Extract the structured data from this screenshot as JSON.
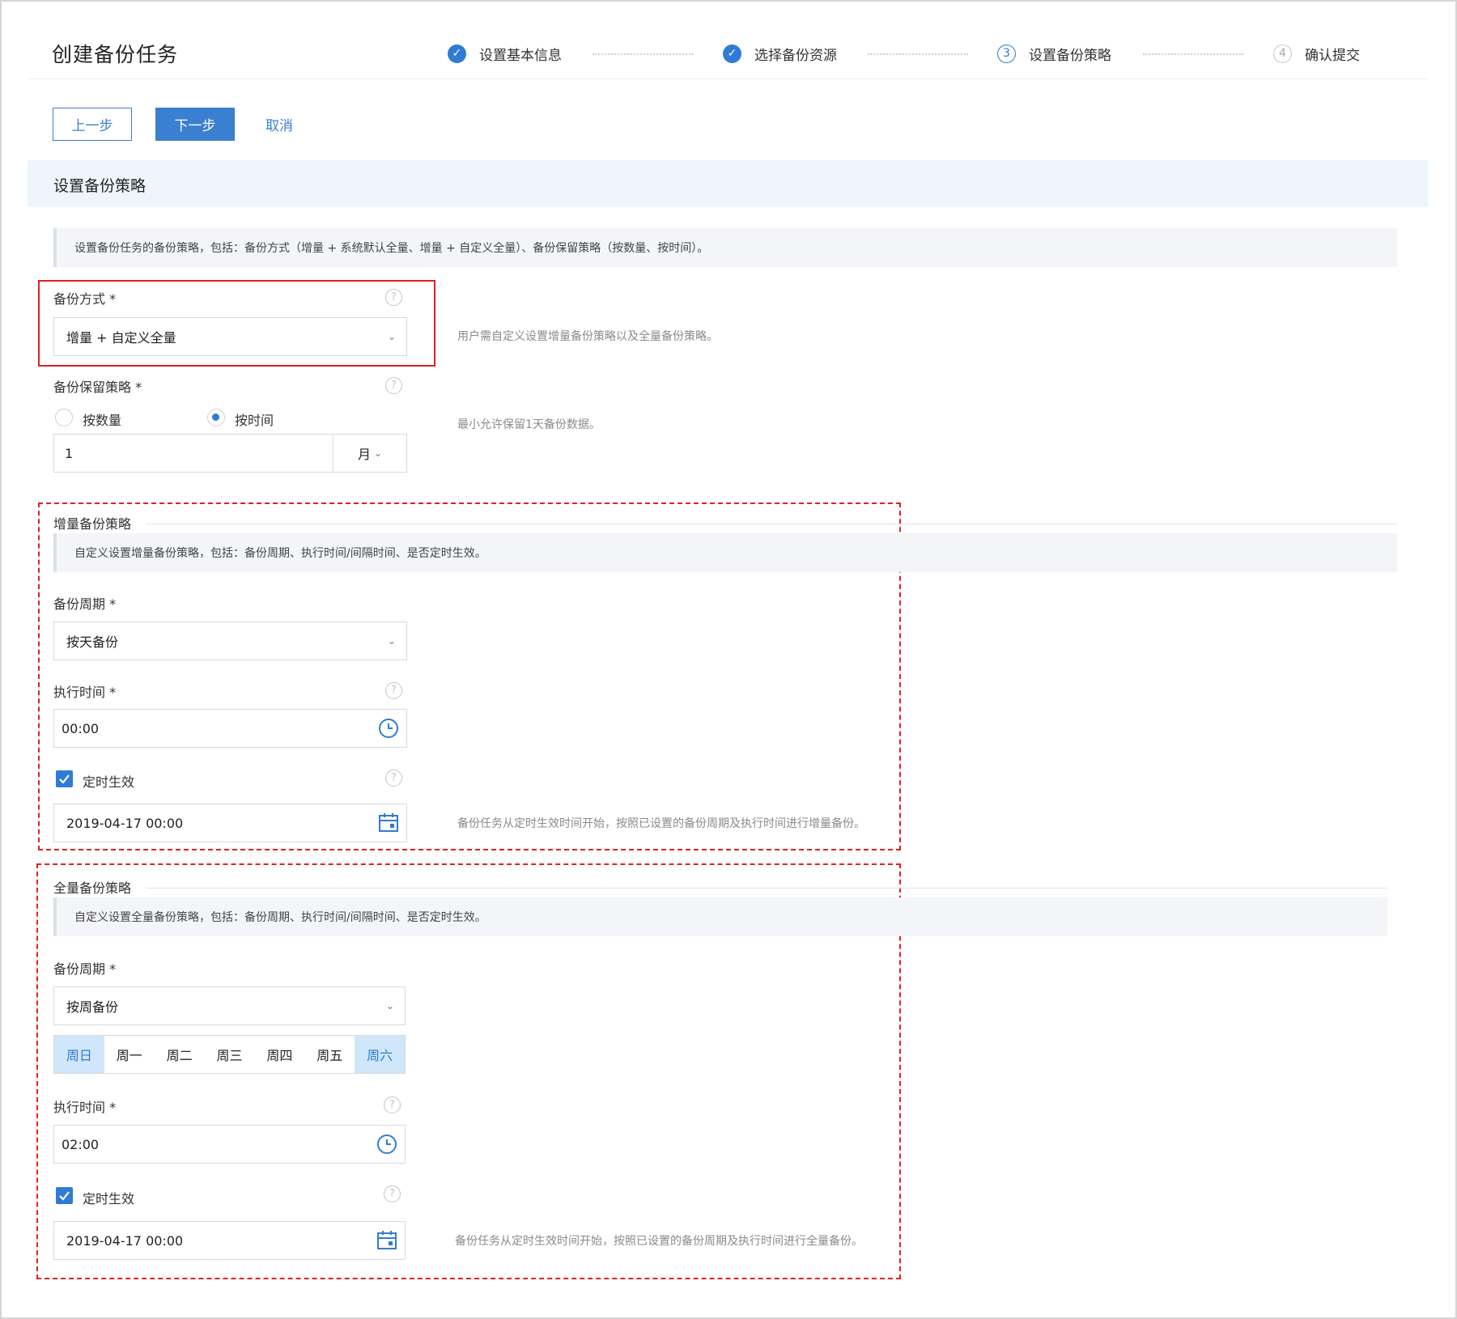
{
  "header": {
    "title": "创建备份任务",
    "steps": [
      {
        "label": "设置基本信息",
        "mark": "✓",
        "state": "done"
      },
      {
        "label": "选择备份资源",
        "mark": "✓",
        "state": "done"
      },
      {
        "label": "设置备份策略",
        "mark": "3",
        "state": "active"
      },
      {
        "label": "确认提交",
        "mark": "4",
        "state": "todo"
      }
    ]
  },
  "toolbar": {
    "prev_label": "上一步",
    "next_label": "下一步",
    "cancel_label": "取消"
  },
  "section": {
    "title": "设置备份策略",
    "notice": "设置备份任务的备份策略，包括：备份方式（增量 + 系统默认全量、增量 + 自定义全量）、备份保留策略（按数量、按时间）。"
  },
  "backup_mode": {
    "label": "备份方式 *",
    "value": "增量 + 自定义全量",
    "hint": "用户需自定义设置增量备份策略以及全量备份策略。"
  },
  "retention": {
    "label": "备份保留策略 *",
    "option_count": "按数量",
    "option_time": "按时间",
    "selected": "按时间",
    "value": "1",
    "unit": "月",
    "hint": "最小允许保留1天备份数据。"
  },
  "incremental": {
    "title": "增量备份策略",
    "notice": "自定义设置增量备份策略，包括：备份周期、执行时间/间隔时间、是否定时生效。",
    "cycle_label": "备份周期 *",
    "cycle_value": "按天备份",
    "time_label": "执行时间 *",
    "time_value": "00:00",
    "timed_label": "定时生效",
    "timed_checked": true,
    "datetime_value": "2019-04-17 00:00",
    "hint": "备份任务从定时生效时间开始，按照已设置的备份周期及执行时间进行增量备份。"
  },
  "full": {
    "title": "全量备份策略",
    "notice": "自定义设置全量备份策略，包括：备份周期、执行时间/间隔时间、是否定时生效。",
    "cycle_label": "备份周期 *",
    "cycle_value": "按周备份",
    "weekdays": [
      "周日",
      "周一",
      "周二",
      "周三",
      "周四",
      "周五",
      "周六"
    ],
    "selected_weekdays": [
      "周日",
      "周六"
    ],
    "time_label": "执行时间 *",
    "time_value": "02:00",
    "timed_label": "定时生效",
    "timed_checked": true,
    "datetime_value": "2019-04-17 00:00",
    "hint": "备份任务从定时生效时间开始，按照已设置的备份周期及执行时间进行全量备份。"
  },
  "colors": {
    "accent": "#2f7bd6",
    "highlight_red": "#e02020",
    "weekday_selected_bg": "#cfe6fb"
  }
}
